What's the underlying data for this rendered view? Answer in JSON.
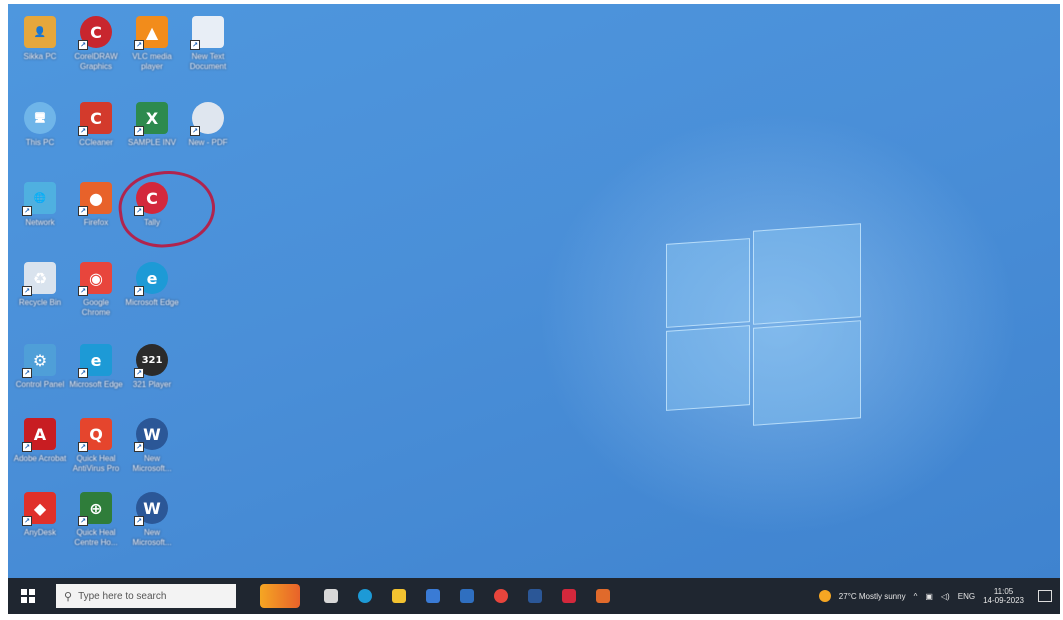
{
  "desktop": {
    "icons": [
      {
        "label": "Sikka PC",
        "glyph": "👤",
        "color": "#e6a73c"
      },
      {
        "label": "CorelDRAW Graphics",
        "glyph": "C",
        "color": "#c8262e"
      },
      {
        "label": "VLC media player",
        "glyph": "▲",
        "color": "#f28c1b"
      },
      {
        "label": "New Text Document",
        "glyph": "",
        "color": "#e8eef6"
      },
      {
        "label": "This PC",
        "glyph": "🖥",
        "color": "#6fb5e9"
      },
      {
        "label": "CCleaner",
        "glyph": "C",
        "color": "#d33a2c"
      },
      {
        "label": "SAMPLE INV",
        "glyph": "X",
        "color": "#2d8a4e"
      },
      {
        "label": "New - PDF",
        "glyph": "",
        "color": "#dfe6ef"
      },
      {
        "label": "Network",
        "glyph": "🌐",
        "color": "#4fb0e0"
      },
      {
        "label": "Firefox",
        "glyph": "●",
        "color": "#e8622a"
      },
      {
        "label": "Tally",
        "glyph": "C",
        "color": "#d3283c"
      },
      {
        "label": "Recycle Bin",
        "glyph": "♻",
        "color": "#d9e3ee"
      },
      {
        "label": "Google Chrome",
        "glyph": "◉",
        "color": "#e8453c"
      },
      {
        "label": "Microsoft Edge",
        "glyph": "e",
        "color": "#1d9ad6"
      },
      {
        "label": "Control Panel",
        "glyph": "⚙",
        "color": "#4f9fd8"
      },
      {
        "label": "Microsoft Edge",
        "glyph": "e",
        "color": "#1d9ad6"
      },
      {
        "label": "321 Player",
        "glyph": "321",
        "color": "#2b2b2b"
      },
      {
        "label": "Adobe Acrobat",
        "glyph": "A",
        "color": "#c81d22"
      },
      {
        "label": "Quick Heal AntiVirus Pro",
        "glyph": "Q",
        "color": "#e5452d"
      },
      {
        "label": "New Microsoft...",
        "glyph": "W",
        "color": "#2b5797"
      },
      {
        "label": "AnyDesk",
        "glyph": "◆",
        "color": "#e0302a"
      },
      {
        "label": "Quick Heal Centre Ho...",
        "glyph": "⊕",
        "color": "#2f7d3a"
      },
      {
        "label": "New Microsoft...",
        "glyph": "W",
        "color": "#2b5797"
      }
    ]
  },
  "taskbar": {
    "search_placeholder": "Type here to search",
    "apps": [
      {
        "name": "task-view",
        "color": "#d8d8d8"
      },
      {
        "name": "edge",
        "color": "#1d9ad6"
      },
      {
        "name": "file-explorer",
        "color": "#f2c230"
      },
      {
        "name": "store",
        "color": "#3a7bd5"
      },
      {
        "name": "mail",
        "color": "#2f6fc0"
      },
      {
        "name": "chrome",
        "color": "#e8453c"
      },
      {
        "name": "word",
        "color": "#2b5797"
      },
      {
        "name": "tally",
        "color": "#d3283c"
      },
      {
        "name": "paint",
        "color": "#e06a2b"
      }
    ],
    "weather": "27°C  Mostly sunny",
    "language": "ENG",
    "time": "11:05",
    "date": "14-09-2023"
  },
  "colors": {
    "desktop": "#4a8fd8",
    "taskbar": "#1f2630",
    "annotation": "#b0244e"
  }
}
